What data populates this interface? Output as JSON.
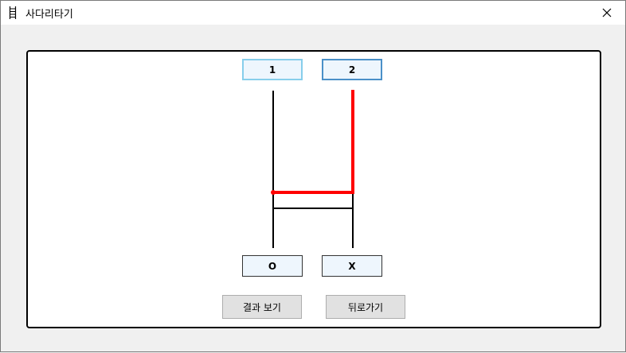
{
  "window": {
    "title": "사다리타기",
    "icon": "ladder-icon",
    "close_icon": "close-icon"
  },
  "ladder": {
    "top_labels": [
      "1",
      "2"
    ],
    "bottom_labels": [
      "O",
      "X"
    ],
    "highlight_color": "#ff0000",
    "line_color": "#000000"
  },
  "buttons": {
    "result_label": "결과 보기",
    "back_label": "뒤로가기"
  }
}
